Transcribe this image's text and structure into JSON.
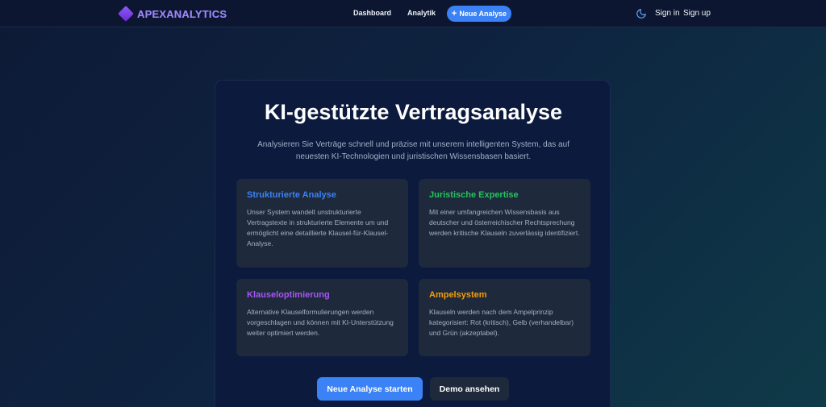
{
  "nav": {
    "brand": "APEXANALYTICS",
    "dashboard": "Dashboard",
    "analytik": "Analytik",
    "new_analysis": "Neue Analyse",
    "sign_in": "Sign in",
    "sign_up": "Sign up"
  },
  "hero": {
    "title": "KI-gestützte Vertragsanalyse",
    "subtitle": "Analysieren Sie Verträge schnell und präzise mit unserem intelligenten System, das auf neuesten KI-Technologien und juristischen Wissensbasen basiert."
  },
  "features": [
    {
      "title": "Strukturierte Analyse",
      "text": "Unser System wandelt unstrukturierte Vertragstexte in strukturierte Elemente um und ermöglicht eine detaillierte Klausel-für-Klausel-Analyse."
    },
    {
      "title": "Juristische Expertise",
      "text": "Mit einer umfangreichen Wissensbasis aus deutscher und österreichischer Rechtsprechung werden kritische Klauseln zuverlässig identifiziert."
    },
    {
      "title": "Klauseloptimierung",
      "text": "Alternative Klauselformulierungen werden vorgeschlagen und können mit KI-Unterstützung weiter optimiert werden."
    },
    {
      "title": "Ampelsystem",
      "text": "Klauseln werden nach dem Ampelprinzip kategorisiert: Rot (kritisch), Gelb (verhandelbar) und Grün (akzeptabel)."
    }
  ],
  "actions": {
    "start": "Neue Analyse starten",
    "demo": "Demo ansehen"
  },
  "colors": {
    "accent": "#3b82f6",
    "feature_1": "#3b82f6",
    "feature_2": "#22c55e",
    "feature_3": "#a855f7",
    "feature_4": "#f59e0b"
  },
  "icons": {
    "brand": "diamond-logo-icon",
    "new_analysis": "plus-icon",
    "theme_toggle": "moon-icon"
  }
}
